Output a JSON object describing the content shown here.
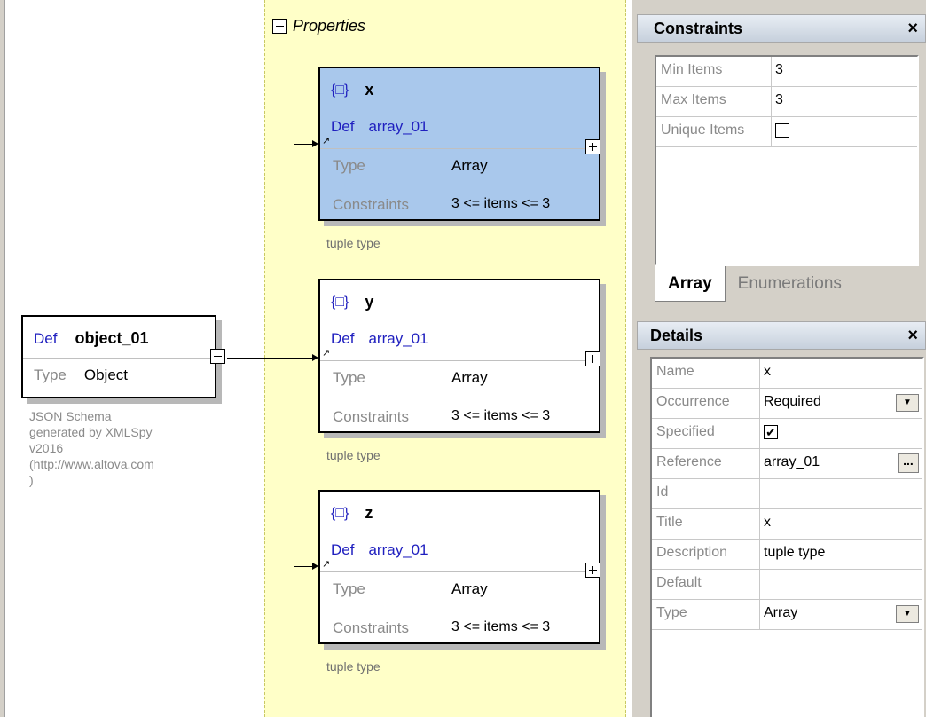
{
  "diagram": {
    "properties_label": "Properties",
    "root": {
      "def_keyword": "Def",
      "def_name": "object_01",
      "type_keyword": "Type",
      "type_value": "Object",
      "note_lines": [
        "JSON Schema",
        "generated by XMLSpy",
        "v2016",
        "(http://www.altova.com",
        ")"
      ]
    },
    "properties": [
      {
        "name": "x",
        "def_keyword": "Def",
        "ref": "array_01",
        "type_keyword": "Type",
        "type_value": "Array",
        "constraints_keyword": "Constraints",
        "constraints_value": "3 <= items <= 3",
        "note": "tuple type",
        "selected": true
      },
      {
        "name": "y",
        "def_keyword": "Def",
        "ref": "array_01",
        "type_keyword": "Type",
        "type_value": "Array",
        "constraints_keyword": "Constraints",
        "constraints_value": "3 <= items <= 3",
        "note": "tuple type",
        "selected": false
      },
      {
        "name": "z",
        "def_keyword": "Def",
        "ref": "array_01",
        "type_keyword": "Type",
        "type_value": "Array",
        "constraints_keyword": "Constraints",
        "constraints_value": "3 <= items <= 3",
        "note": "tuple type",
        "selected": false
      }
    ],
    "icon_glyph": "{□}",
    "arrow_glyph": "↗"
  },
  "constraints_panel": {
    "title": "Constraints",
    "close": "×",
    "rows": [
      {
        "key": "Min Items",
        "value": "3"
      },
      {
        "key": "Max Items",
        "value": "3"
      },
      {
        "key": "Unique Items",
        "value": ""
      }
    ],
    "tabs": [
      {
        "label": "Array",
        "active": true
      },
      {
        "label": "Enumerations",
        "active": false
      }
    ]
  },
  "details_panel": {
    "title": "Details",
    "close": "×",
    "rows": [
      {
        "key": "Name",
        "value": "x"
      },
      {
        "key": "Occurrence",
        "value": "Required"
      },
      {
        "key": "Specified",
        "value": ""
      },
      {
        "key": "Reference",
        "value": "array_01"
      },
      {
        "key": "Id",
        "value": ""
      },
      {
        "key": "Title",
        "value": "x"
      },
      {
        "key": "Description",
        "value": "tuple type"
      },
      {
        "key": "Default",
        "value": ""
      },
      {
        "key": "Type",
        "value": "Array"
      }
    ],
    "checkmark": "✔",
    "dropdown_glyph": "▼",
    "ellipsis": "..."
  },
  "colors": {
    "selection": "#a9c8ec",
    "properties_band": "#ffffc8",
    "keyword": "#1f1fbf"
  }
}
